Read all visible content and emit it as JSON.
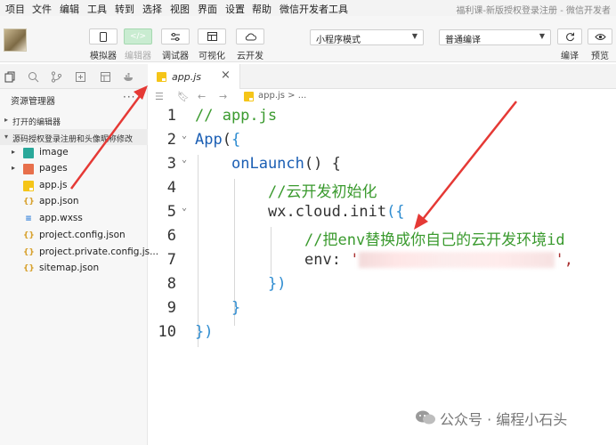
{
  "menu": [
    "项目",
    "文件",
    "编辑",
    "工具",
    "转到",
    "选择",
    "视图",
    "界面",
    "设置",
    "帮助",
    "微信开发者工具"
  ],
  "window_title": "福利课-新版授权登录注册 - 微信开发者",
  "toolbar": {
    "simulator": "模拟器",
    "editor": "编辑器",
    "debugger": "调试器",
    "visual": "可视化",
    "cloud": "云开发",
    "mode_select": "小程序模式",
    "compile_select": "普通编译",
    "compile": "编译",
    "preview": "预览"
  },
  "tab": {
    "file_name": "app.js",
    "close": "×"
  },
  "breadcrumb": "app.js > ...",
  "explorer": {
    "title": "资源管理器",
    "more": "···",
    "open_editors": "打开的编辑器",
    "project": "源码授权登录注册和头像昵称修改",
    "items": [
      {
        "label": "image"
      },
      {
        "label": "pages"
      },
      {
        "label": "app.js"
      },
      {
        "label": "app.json"
      },
      {
        "label": "app.wxss"
      },
      {
        "label": "project.config.json"
      },
      {
        "label": "project.private.config.js..."
      },
      {
        "label": "sitemap.json"
      }
    ]
  },
  "code": {
    "line_numbers": [
      "1",
      "2",
      "3",
      "4",
      "5",
      "6",
      "7",
      "8",
      "9",
      "10"
    ],
    "l1": "// app.js",
    "l2_name": "App",
    "l2_paren": "(",
    "l2_brace": "{",
    "l3_name": "onLaunch",
    "l3_rest": "() {",
    "l4": "//云开发初始化",
    "l5_obj": "wx.cloud.init",
    "l5_rest": "({",
    "l6": "//把env替换成你自己的云开发环境id",
    "l7_key": "env:",
    "l7_quote": "'",
    "l7_end": "',",
    "l8": "})",
    "l9": "}",
    "l10": "})"
  },
  "watermark": "公众号 · 编程小石头",
  "colors": {
    "accent_green": "#07c160",
    "arrow_red": "#e53935"
  }
}
